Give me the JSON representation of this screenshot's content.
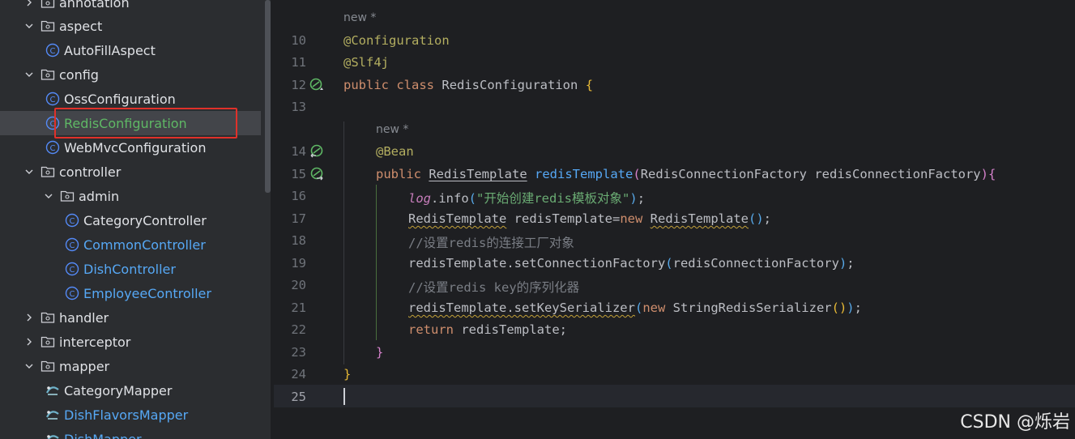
{
  "project_tree": {
    "items": [
      {
        "label": "annotation",
        "type": "folder",
        "expanded": false,
        "depth": 1,
        "color": "default"
      },
      {
        "label": "aspect",
        "type": "folder",
        "expanded": true,
        "depth": 1,
        "color": "default"
      },
      {
        "label": "AutoFillAspect",
        "type": "class",
        "depth": 2,
        "color": "default"
      },
      {
        "label": "config",
        "type": "folder",
        "expanded": true,
        "depth": 1,
        "color": "default"
      },
      {
        "label": "OssConfiguration",
        "type": "class",
        "depth": 2,
        "color": "default"
      },
      {
        "label": "RedisConfiguration",
        "type": "class",
        "depth": 2,
        "color": "green",
        "selected": true
      },
      {
        "label": "WebMvcConfiguration",
        "type": "class",
        "depth": 2,
        "color": "default"
      },
      {
        "label": "controller",
        "type": "folder",
        "expanded": true,
        "depth": 1,
        "color": "default"
      },
      {
        "label": "admin",
        "type": "folder",
        "expanded": true,
        "depth": 2,
        "color": "default"
      },
      {
        "label": "CategoryController",
        "type": "class",
        "depth": 3,
        "color": "default"
      },
      {
        "label": "CommonController",
        "type": "class",
        "depth": 3,
        "color": "blue"
      },
      {
        "label": "DishController",
        "type": "class",
        "depth": 3,
        "color": "blue"
      },
      {
        "label": "EmployeeController",
        "type": "class",
        "depth": 3,
        "color": "blue"
      },
      {
        "label": "handler",
        "type": "folder",
        "expanded": false,
        "depth": 1,
        "color": "default"
      },
      {
        "label": "interceptor",
        "type": "folder",
        "expanded": false,
        "depth": 1,
        "color": "default"
      },
      {
        "label": "mapper",
        "type": "folder",
        "expanded": true,
        "depth": 1,
        "color": "default"
      },
      {
        "label": "CategoryMapper",
        "type": "mapper",
        "depth": 2,
        "color": "default"
      },
      {
        "label": "DishFlavorsMapper",
        "type": "mapper",
        "depth": 2,
        "color": "blue"
      },
      {
        "label": "DishMapper",
        "type": "mapper",
        "depth": 2,
        "color": "blue"
      }
    ]
  },
  "editor": {
    "hint_new": "new *",
    "line_numbers": [
      "10",
      "11",
      "12",
      "13",
      "14",
      "15",
      "16",
      "17",
      "18",
      "19",
      "20",
      "21",
      "22",
      "23",
      "24",
      "25"
    ],
    "current_line": "25",
    "code": {
      "l10": "@Configuration",
      "l11": "@Slf4j",
      "l12_k1": "public",
      "l12_k2": "class",
      "l12_name": "RedisConfiguration",
      "l14": "@Bean",
      "l15_k": "public",
      "l15_type": "RedisTemplate",
      "l15_fn": "redisTemplate",
      "l15_ptype": "RedisConnectionFactory",
      "l15_pname": "redisConnectionFactory",
      "l16_log": "log",
      "l16_info": ".info",
      "l16_str": "\"开始创建redis模板对象\"",
      "l17_type": "RedisTemplate",
      "l17_var": "redisTemplate=",
      "l17_new": "new",
      "l17_ctor": "RedisTemplate",
      "l18": "//设置redis的连接工厂对象",
      "l19_a": "redisTemplate.setConnectionFactory",
      "l19_b": "redisConnectionFactory",
      "l20": "//设置redis key的序列化器",
      "l21_a": "redisTemplate.setKeySerializer",
      "l21_new": "new",
      "l21_b": "StringRedisSerializer",
      "l22_k": "return",
      "l22_v": "redisTemplate;"
    },
    "gutter_icons": [
      "bean-gutter-icon",
      "bean-gutter-icon",
      "bean-gutter-icon"
    ]
  },
  "watermark": "CSDN @烁岩",
  "colors": {
    "keyword": "#cf8e6d",
    "annotation": "#b3ae60",
    "function": "#56a8f5",
    "string": "#6aab73",
    "comment": "#7a7e85",
    "selection_box": "#e0312a"
  }
}
